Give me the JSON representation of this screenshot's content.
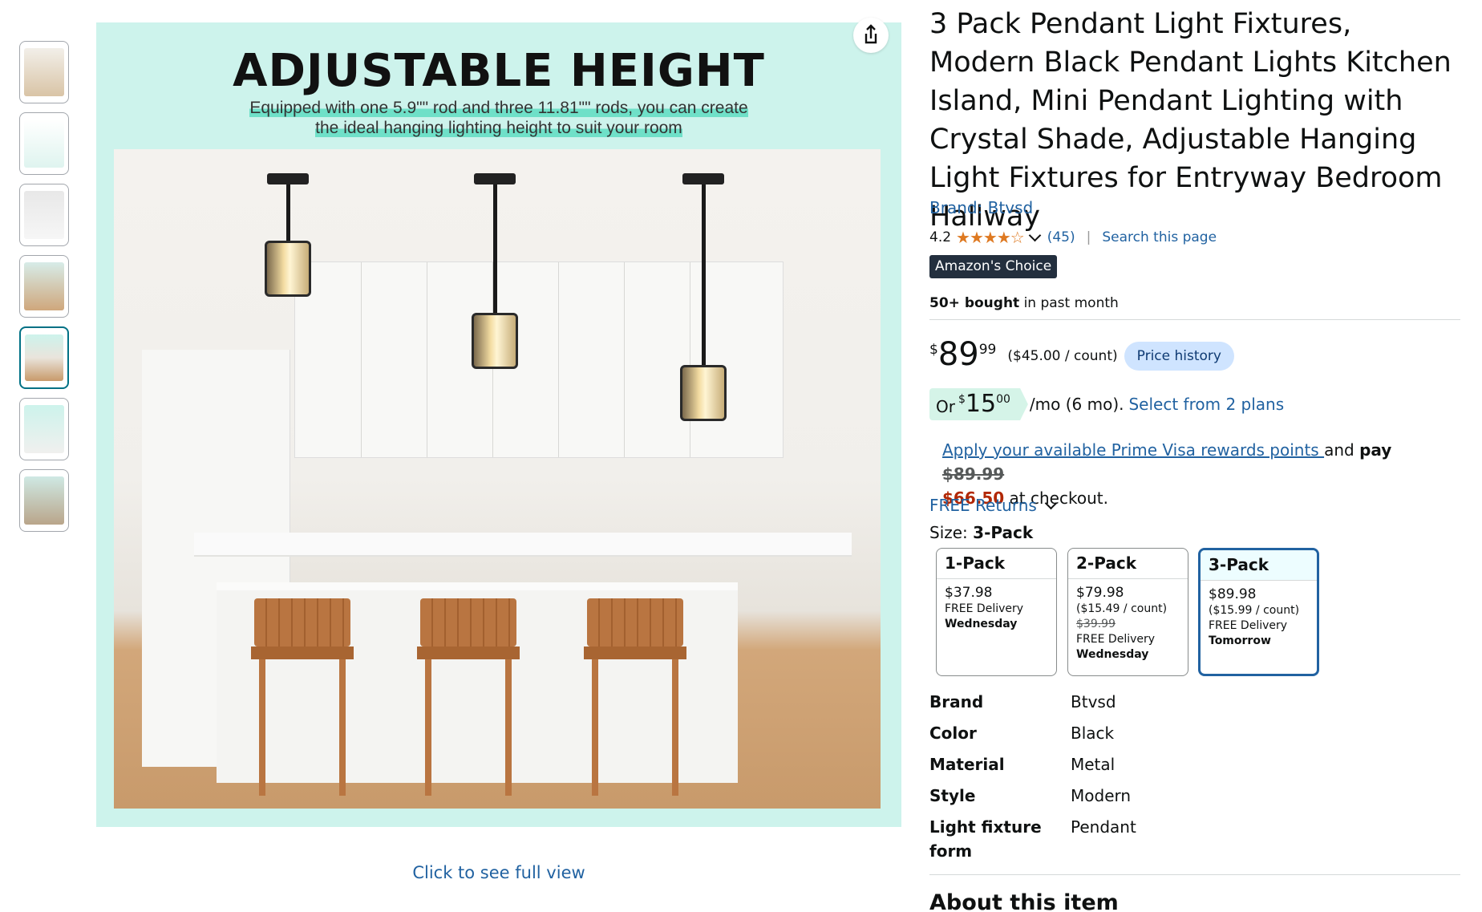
{
  "thumbnails": [
    {
      "name": "thumb-1"
    },
    {
      "name": "thumb-2"
    },
    {
      "name": "thumb-3"
    },
    {
      "name": "thumb-4"
    },
    {
      "name": "thumb-5"
    },
    {
      "name": "thumb-6"
    },
    {
      "name": "thumb-7"
    }
  ],
  "image": {
    "headline": "ADJUSTABLE HEIGHT",
    "subline1": "Equipped with one 5.9\"\" rod and three 11.81\"\" rods, you can create",
    "subline2": "the ideal hanging lighting height to suit your room",
    "full_view_link": "Click to see full view",
    "share_icon": "share-icon"
  },
  "product": {
    "title": "3 Pack Pendant Light Fixtures, Modern Black Pendant Lights Kitchen Island, Mini Pendant Lighting with Crystal Shade, Adjustable Hanging Light Fixtures for Entryway Bedroom Hallway",
    "brand_link": "Brand: Btvsd",
    "rating": "4.2",
    "stars": "★★★★☆",
    "rating_count": "(45)",
    "search_page": "Search this page",
    "badge": "Amazon's Choice",
    "bought_bold": "50+ bought",
    "bought_rest": " in past month"
  },
  "price": {
    "symbol": "$",
    "whole": "89",
    "fraction": "99",
    "unit": "($45.00 / count)",
    "history_button": "Price history"
  },
  "monthly": {
    "or": "Or",
    "symbol": "$",
    "whole": "15",
    "fraction": "00",
    "term": "/mo (6 mo).",
    "plans_link": "Select from 2 plans"
  },
  "visa": {
    "link": "Apply your available Prime Visa rewards points ",
    "and": "and ",
    "pay": "pay",
    "old_price": "$89.99",
    "new_price": "$66.50",
    "tail": " at checkout."
  },
  "returns": "FREE Returns",
  "size": {
    "label": "Size: ",
    "selected": "3-Pack",
    "options": [
      {
        "name": "1-Pack",
        "price": "$37.98",
        "unit": "",
        "list": "",
        "delivery": "FREE Delivery",
        "day": "Wednesday"
      },
      {
        "name": "2-Pack",
        "price": "$79.98",
        "unit": "($15.49 / count)",
        "list": "$39.99",
        "delivery": "FREE Delivery",
        "day": "Wednesday"
      },
      {
        "name": "3-Pack",
        "price": "$89.98",
        "unit": "($15.99 / count)",
        "list": "",
        "delivery": "FREE Delivery",
        "day": "Tomorrow"
      }
    ]
  },
  "specs": [
    {
      "key": "Brand",
      "value": "Btvsd"
    },
    {
      "key": "Color",
      "value": "Black"
    },
    {
      "key": "Material",
      "value": "Metal"
    },
    {
      "key": "Style",
      "value": "Modern"
    },
    {
      "key": "Light fixture form",
      "value": "Pendant"
    }
  ],
  "about_heading": "About this item",
  "colors": {
    "link": "#2162a1",
    "star": "#de7921",
    "deal_red": "#b12704",
    "badge_bg": "#232f3e",
    "selected_border": "#2162a1"
  }
}
